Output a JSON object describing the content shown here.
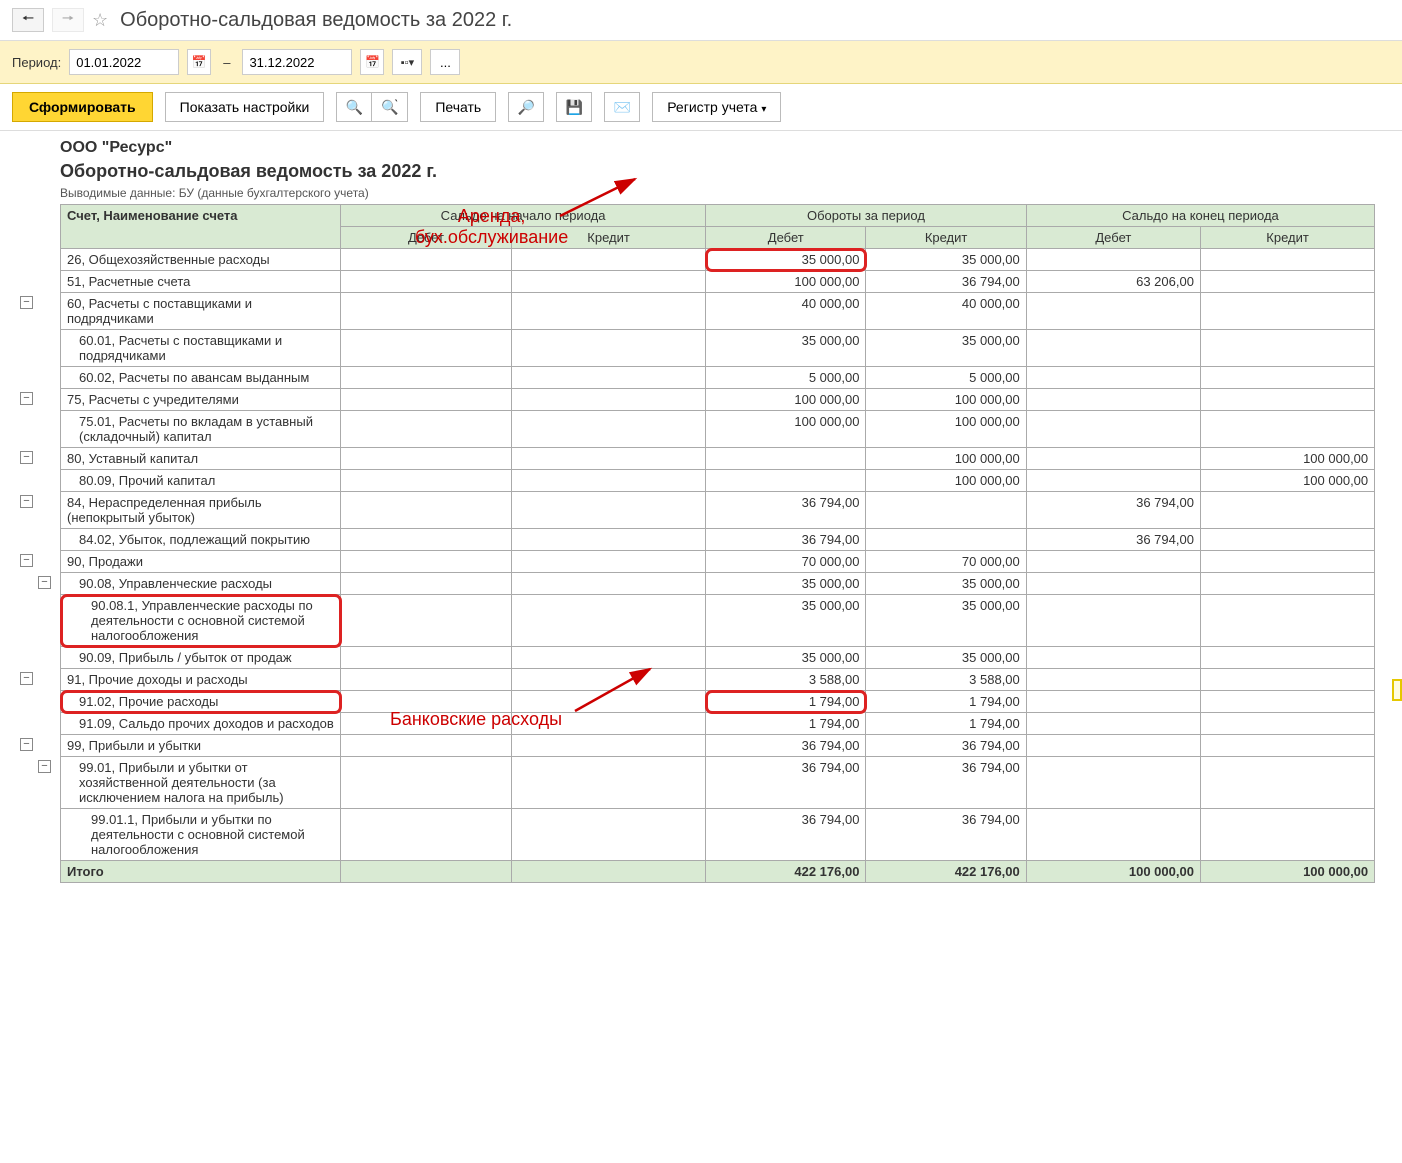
{
  "titlebar": {
    "title": "Оборотно-сальдовая ведомость за 2022 г."
  },
  "period": {
    "label": "Период:",
    "from": "01.01.2022",
    "to": "31.12.2022"
  },
  "toolbar": {
    "generate": "Сформировать",
    "show_settings": "Показать настройки",
    "print": "Печать",
    "register": "Регистр учета"
  },
  "report": {
    "company": "ООО \"Ресурс\"",
    "title": "Оборотно-сальдовая ведомость за 2022 г.",
    "subtitle": "Выводимые данные: БУ (данные бухгалтерского учета)"
  },
  "headers": {
    "account": "Счет, Наименование счета",
    "opening": "Сальдо на начало периода",
    "turnover": "Обороты за период",
    "closing": "Сальдо на конец периода",
    "debit": "Дебет",
    "credit": "Кредит"
  },
  "rows": [
    {
      "name": "26, Общехозяйственные расходы",
      "indent": 0,
      "od": "",
      "oc": "",
      "td": "35 000,00",
      "tc": "35 000,00",
      "cd": "",
      "cc": "",
      "hl_td": true
    },
    {
      "name": "51, Расчетные счета",
      "indent": 0,
      "od": "",
      "oc": "",
      "td": "100 000,00",
      "tc": "36 794,00",
      "cd": "63 206,00",
      "cc": ""
    },
    {
      "name": "60, Расчеты с поставщиками и подрядчиками",
      "indent": 0,
      "od": "",
      "oc": "",
      "td": "40 000,00",
      "tc": "40 000,00",
      "cd": "",
      "cc": ""
    },
    {
      "name": "60.01, Расчеты с поставщиками и подрядчиками",
      "indent": 1,
      "od": "",
      "oc": "",
      "td": "35 000,00",
      "tc": "35 000,00",
      "cd": "",
      "cc": ""
    },
    {
      "name": "60.02, Расчеты по авансам выданным",
      "indent": 1,
      "od": "",
      "oc": "",
      "td": "5 000,00",
      "tc": "5 000,00",
      "cd": "",
      "cc": ""
    },
    {
      "name": "75, Расчеты с учредителями",
      "indent": 0,
      "od": "",
      "oc": "",
      "td": "100 000,00",
      "tc": "100 000,00",
      "cd": "",
      "cc": ""
    },
    {
      "name": "75.01, Расчеты по вкладам в уставный (складочный) капитал",
      "indent": 1,
      "od": "",
      "oc": "",
      "td": "100 000,00",
      "tc": "100 000,00",
      "cd": "",
      "cc": ""
    },
    {
      "name": "80, Уставный капитал",
      "indent": 0,
      "od": "",
      "oc": "",
      "td": "",
      "tc": "100 000,00",
      "cd": "",
      "cc": "100 000,00"
    },
    {
      "name": "80.09, Прочий капитал",
      "indent": 1,
      "od": "",
      "oc": "",
      "td": "",
      "tc": "100 000,00",
      "cd": "",
      "cc": "100 000,00"
    },
    {
      "name": "84, Нераспределенная прибыль (непокрытый убыток)",
      "indent": 0,
      "od": "",
      "oc": "",
      "td": "36 794,00",
      "tc": "",
      "cd": "36 794,00",
      "cc": ""
    },
    {
      "name": "84.02, Убыток, подлежащий покрытию",
      "indent": 1,
      "od": "",
      "oc": "",
      "td": "36 794,00",
      "tc": "",
      "cd": "36 794,00",
      "cc": ""
    },
    {
      "name": "90, Продажи",
      "indent": 0,
      "od": "",
      "oc": "",
      "td": "70 000,00",
      "tc": "70 000,00",
      "cd": "",
      "cc": ""
    },
    {
      "name": "90.08, Управленческие расходы",
      "indent": 1,
      "od": "",
      "oc": "",
      "td": "35 000,00",
      "tc": "35 000,00",
      "cd": "",
      "cc": ""
    },
    {
      "name": "90.08.1, Управленческие расходы по деятельности с основной системой налогообложения",
      "indent": 2,
      "od": "",
      "oc": "",
      "td": "35 000,00",
      "tc": "35 000,00",
      "cd": "",
      "cc": "",
      "hl_name": true
    },
    {
      "name": "90.09, Прибыль / убыток от продаж",
      "indent": 1,
      "od": "",
      "oc": "",
      "td": "35 000,00",
      "tc": "35 000,00",
      "cd": "",
      "cc": ""
    },
    {
      "name": "91, Прочие доходы и расходы",
      "indent": 0,
      "od": "",
      "oc": "",
      "td": "3 588,00",
      "tc": "3 588,00",
      "cd": "",
      "cc": ""
    },
    {
      "name": "91.02, Прочие расходы",
      "indent": 1,
      "od": "",
      "oc": "",
      "td": "1 794,00",
      "tc": "1 794,00",
      "cd": "",
      "cc": "",
      "hl_name": true,
      "hl_td": true
    },
    {
      "name": "91.09, Сальдо прочих доходов и расходов",
      "indent": 1,
      "od": "",
      "oc": "",
      "td": "1 794,00",
      "tc": "1 794,00",
      "cd": "",
      "cc": ""
    },
    {
      "name": "99, Прибыли и убытки",
      "indent": 0,
      "od": "",
      "oc": "",
      "td": "36 794,00",
      "tc": "36 794,00",
      "cd": "",
      "cc": ""
    },
    {
      "name": "99.01, Прибыли и убытки от хозяйственной деятельности (за исключением налога на прибыль)",
      "indent": 1,
      "od": "",
      "oc": "",
      "td": "36 794,00",
      "tc": "36 794,00",
      "cd": "",
      "cc": ""
    },
    {
      "name": "99.01.1, Прибыли и убытки по деятельности с основной системой налогообложения",
      "indent": 2,
      "od": "",
      "oc": "",
      "td": "36 794,00",
      "tc": "36 794,00",
      "cd": "",
      "cc": ""
    }
  ],
  "total": {
    "label": "Итого",
    "td": "422 176,00",
    "tc": "422 176,00",
    "cd": "100 000,00",
    "cc": "100 000,00"
  },
  "annotations": {
    "a1": "Аренда,\nбух.обслуживание",
    "a2": "Банковские расходы"
  },
  "toggles": [
    {
      "row": 2,
      "level": 1
    },
    {
      "row": 5,
      "level": 1
    },
    {
      "row": 7,
      "level": 1
    },
    {
      "row": 9,
      "level": 1
    },
    {
      "row": 11,
      "level": 1
    },
    {
      "row": 12,
      "level": 2
    },
    {
      "row": 15,
      "level": 1
    },
    {
      "row": 18,
      "level": 1
    },
    {
      "row": 19,
      "level": 2
    }
  ]
}
